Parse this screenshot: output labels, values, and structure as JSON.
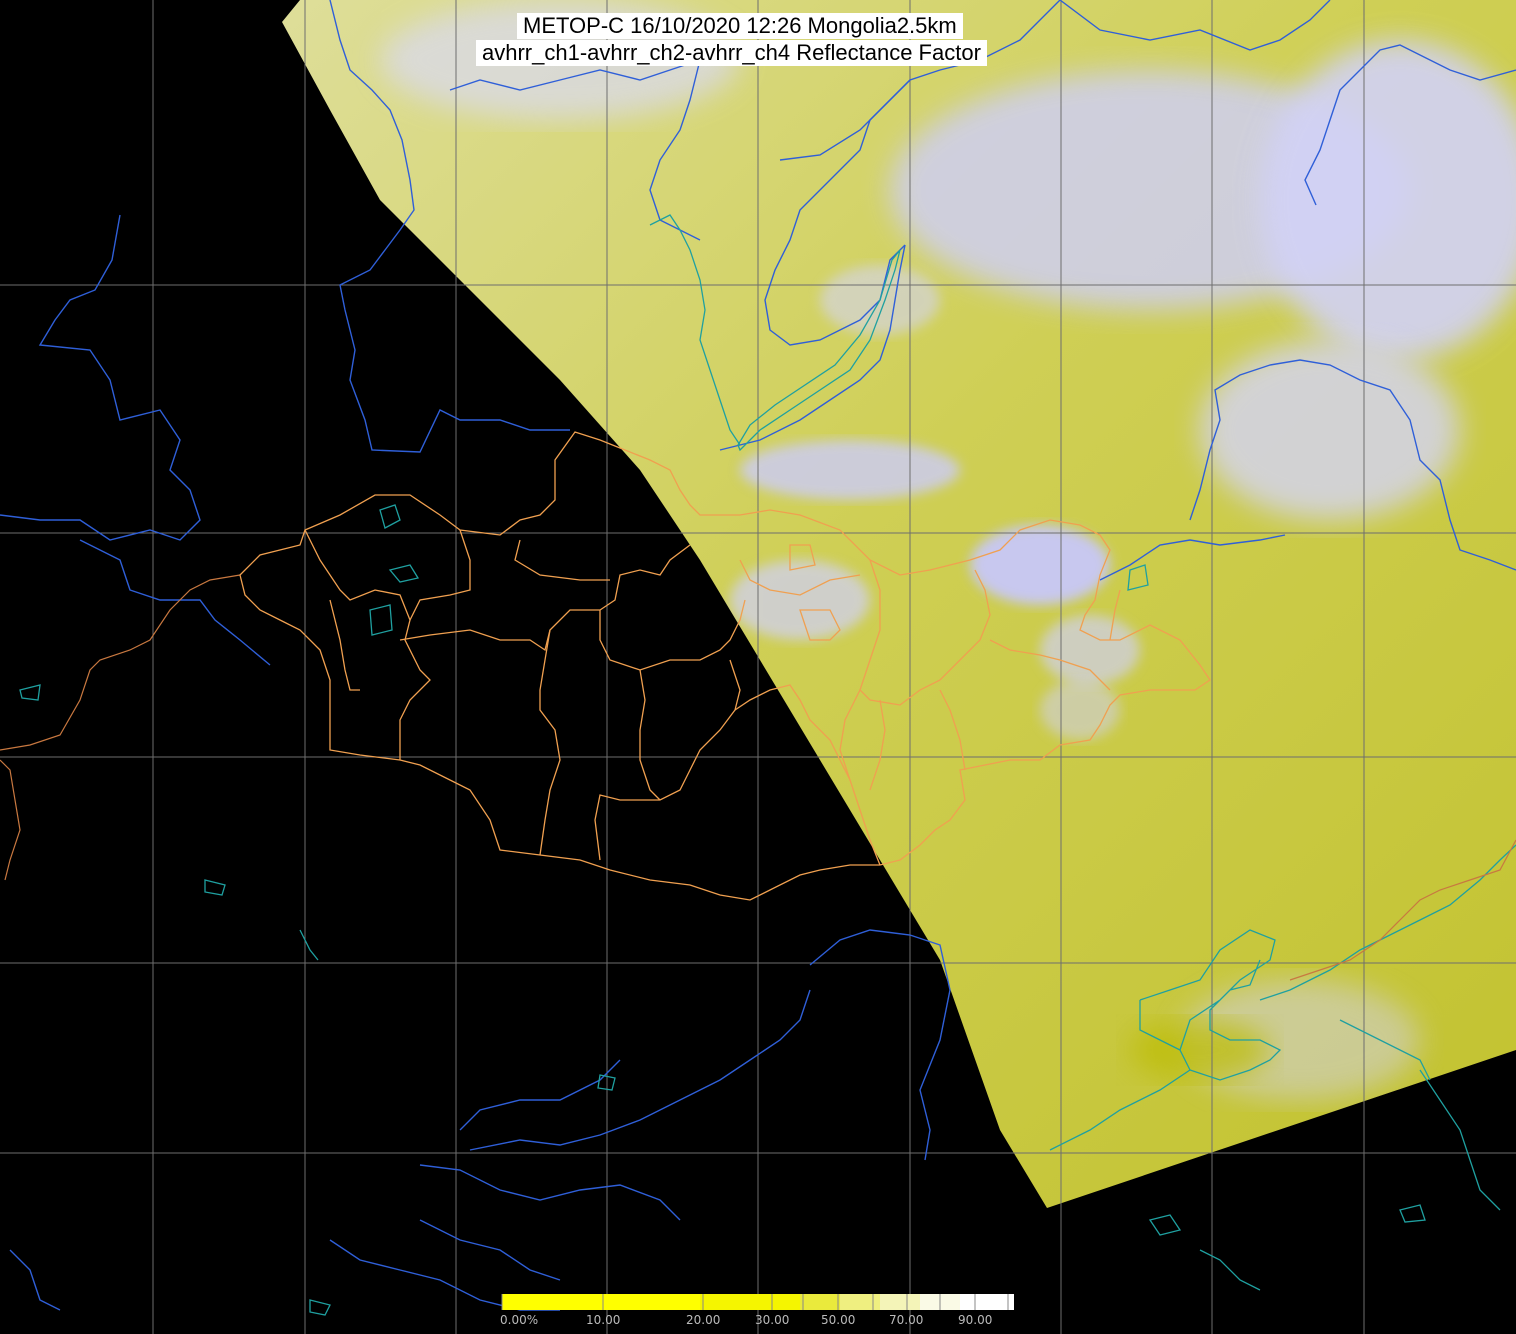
{
  "title": {
    "line1": "METOP-C 16/10/2020 12:26 Mongolia2.5km",
    "line2": "avhrr_ch1-avhrr_ch2-avhrr_ch4 Reflectance Factor"
  },
  "colorbar": {
    "labels": [
      "0.00%",
      "10.00",
      "20.00",
      "30.00",
      "50.00",
      "70.00",
      "90.00"
    ],
    "colors": [
      "#ffff00",
      "#f4f400",
      "#ecec3a",
      "#f0f08a",
      "#f6f6c8",
      "#fbfbee",
      "#ffffff"
    ]
  },
  "colors": {
    "background": "#000000",
    "swath_base": "#c4c43a",
    "cloud": "#c8c8f0",
    "graticule": "#6e6e6e",
    "coastline": "#2f5fd8",
    "lakes": "#1fa0a0",
    "provinces": "#f0a050",
    "country_border": "#c87840"
  },
  "layers": {
    "satellite_swath": "visible",
    "graticule": "visible",
    "rivers": "visible",
    "admin_boundaries": "visible"
  }
}
